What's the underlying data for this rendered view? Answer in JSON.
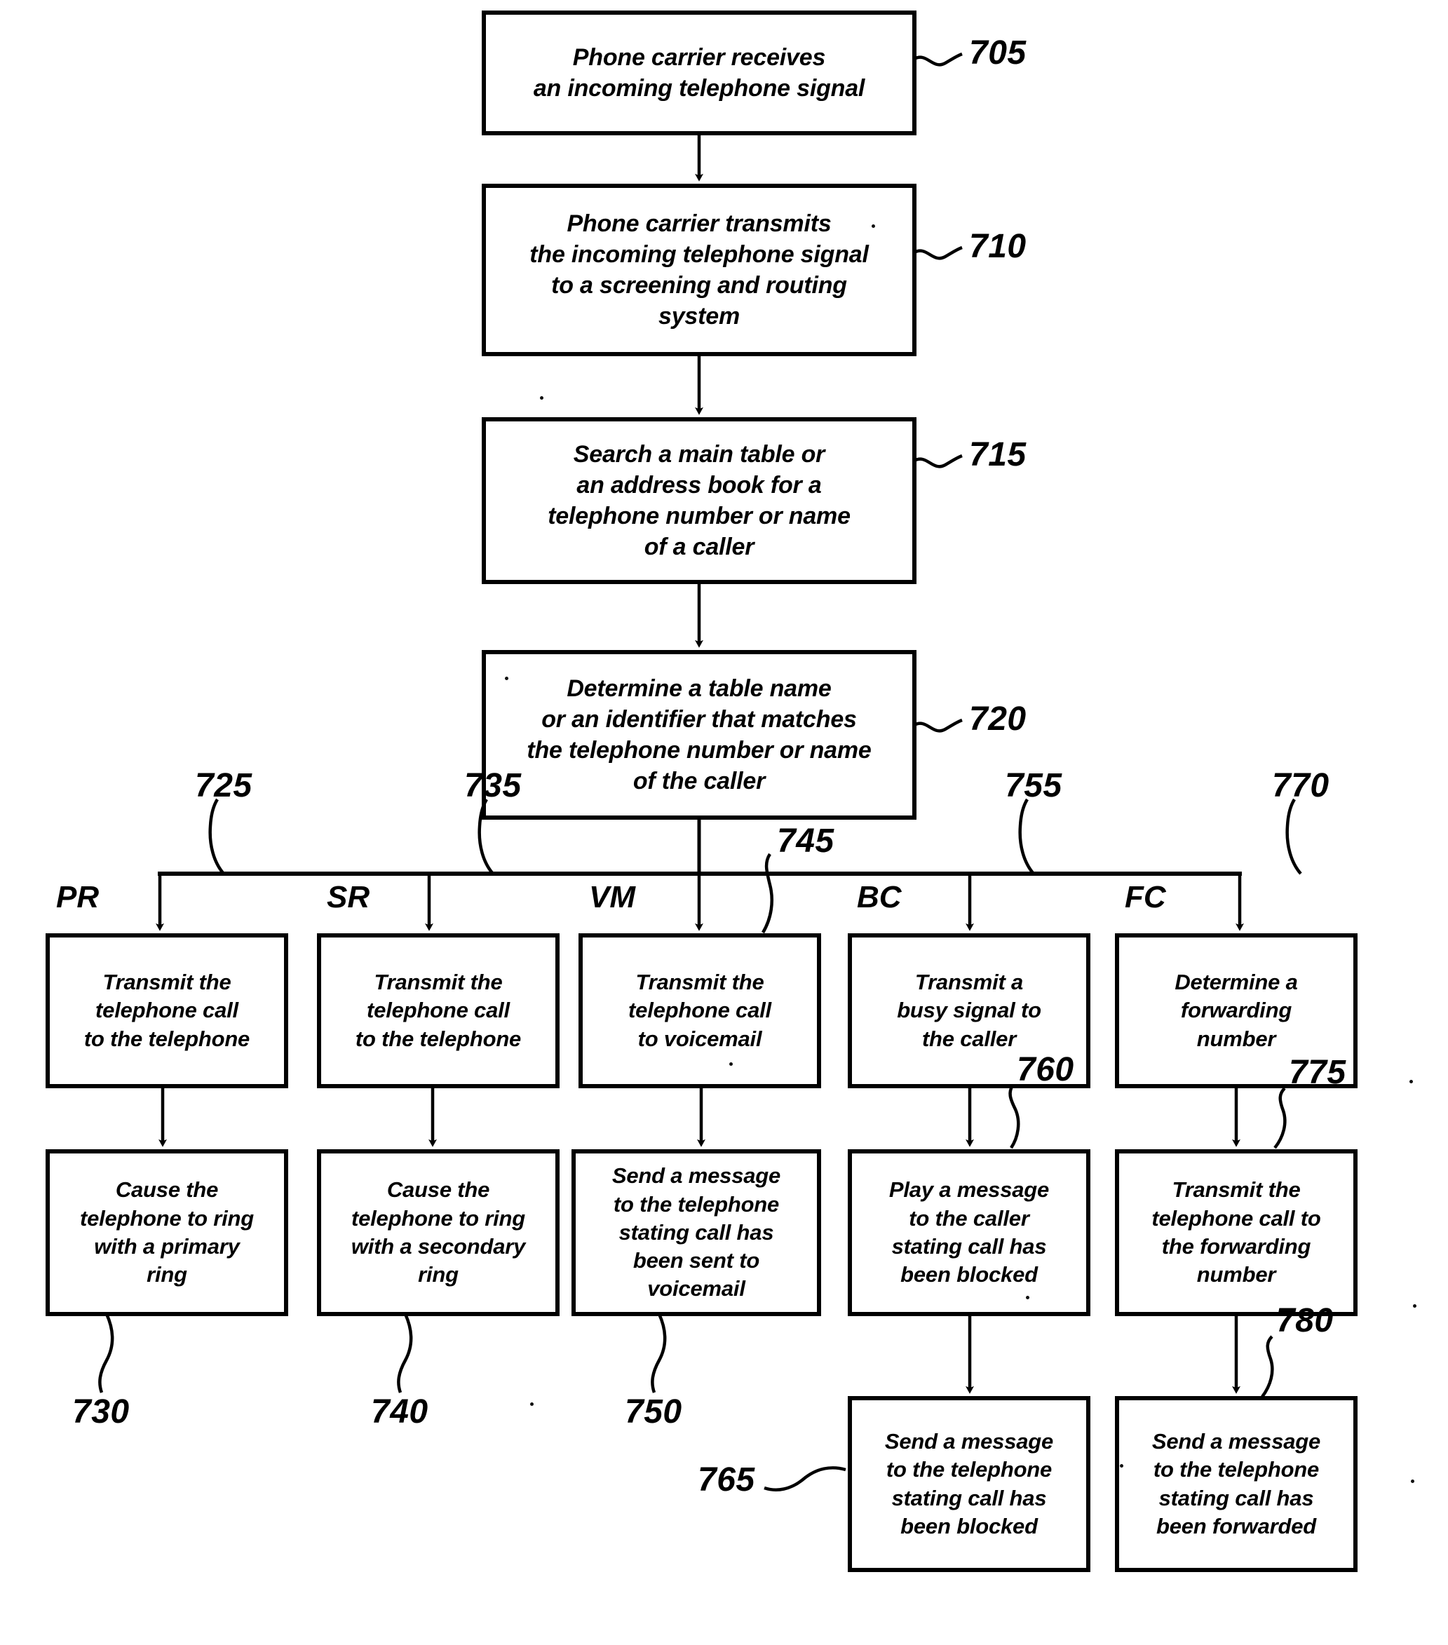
{
  "figure": {
    "type": "patent-flowchart",
    "title": "",
    "stroke_color": "#000000",
    "background_color": "#ffffff"
  },
  "boxes": {
    "b705": "Phone carrier receives\nan incoming telephone signal",
    "b710": "Phone carrier transmits\nthe incoming telephone signal\nto a screening and routing\nsystem",
    "b715": "Search a main table or\nan address book for a\ntelephone number or name\nof a caller",
    "b720": "Determine a table name\nor an identifier that matches\nthe telephone number or name\nof the caller",
    "b725": "Transmit the\ntelephone call\nto the telephone",
    "b730": "Cause the\ntelephone to ring\nwith a primary\nring",
    "b735": "Transmit the\ntelephone call\nto the telephone",
    "b740": "Cause the\ntelephone to ring\nwith a secondary\nring",
    "b745": "Transmit the\ntelephone call\nto voicemail",
    "b750": "Send a message\nto the telephone\nstating call has\nbeen sent to\nvoicemail",
    "b755": "Transmit a\nbusy signal to\nthe caller",
    "b760": "Play a message\nto the caller\nstating call has\nbeen blocked",
    "b765": "Send a message\nto the telephone\nstating call has\nbeen blocked",
    "b770": "Determine a\nforwarding\nnumber",
    "b775": "Transmit the\ntelephone call to\nthe forwarding\nnumber",
    "b780": "Send a message\nto the telephone\nstating call has\nbeen forwarded"
  },
  "reference_numerals": {
    "n705": "705",
    "n710": "710",
    "n715": "715",
    "n720": "720",
    "n725": "725",
    "n730": "730",
    "n735": "735",
    "n740": "740",
    "n745": "745",
    "n750": "750",
    "n755": "755",
    "n760": "760",
    "n765": "765",
    "n770": "770",
    "n775": "775",
    "n780": "780"
  },
  "branch_labels": {
    "pr": "PR",
    "sr": "SR",
    "vm": "VM",
    "bc": "BC",
    "fc": "FC"
  }
}
